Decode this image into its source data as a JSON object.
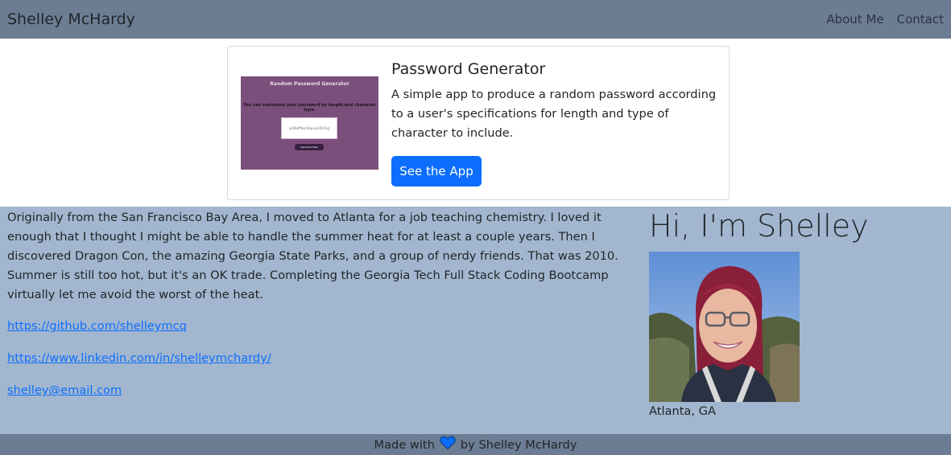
{
  "nav": {
    "brand": "Shelley McHardy",
    "links": [
      "About Me",
      "Contact"
    ]
  },
  "project": {
    "thumbnail": {
      "title": "Random Password Generator",
      "subtitle": "You can customize your password by length and character type.",
      "sample": "ys3hdf%er3nw-ps!2b7vq",
      "button": "Generate Pass"
    },
    "title": "Password Generator",
    "description": "A simple app to produce a random password according to a user's specifications for length and type of character to include.",
    "button": "See the App"
  },
  "about": {
    "bio": "Originally from the San Francisco Bay Area, I moved to Atlanta for a job teaching chemistry. I loved it enough that I thought I might be able to handle the summer heat for at least a couple years. Then I discovered Dragon Con, the amazing Georgia State Parks, and a group of nerdy friends. That was 2010. Summer is still too hot, but it's an OK trade. Completing the Georgia Tech Full Stack Coding Bootcamp virtually let me avoid the worst of the heat.",
    "links": [
      "https://github.com/shelleymcq",
      "https://www.linkedin.com/in/shelleymchardy/",
      "shelley@email.com"
    ],
    "heading": "Hi, I'm Shelley",
    "location": "Atlanta, GA"
  },
  "footer": {
    "before": "Made with",
    "after": "by Shelley McHardy",
    "icon": "heart-icon"
  },
  "colors": {
    "navbar": "#6c7d93",
    "about_bg": "#a2b7cf",
    "primary": "#0d6efd",
    "thumb_bg": "#7b4f7b"
  }
}
